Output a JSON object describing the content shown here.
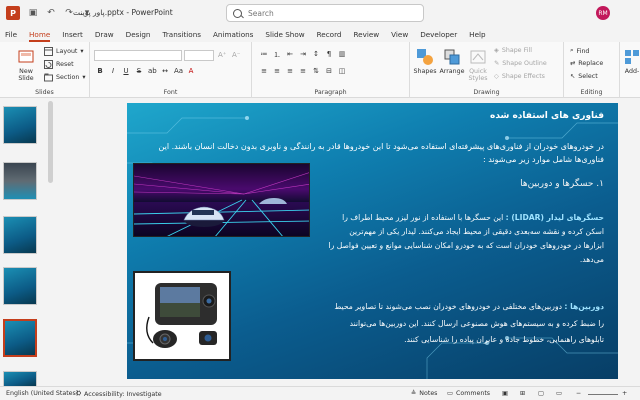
{
  "titlebar": {
    "doc_title": "پاور پوینت.pptx  -  PowerPoint",
    "search_placeholder": "Search",
    "avatar_initials": "RM"
  },
  "tabs": [
    "File",
    "Home",
    "Insert",
    "Draw",
    "Design",
    "Transitions",
    "Animations",
    "Slide Show",
    "Record",
    "Review",
    "View",
    "Developer",
    "Help"
  ],
  "active_tab": "Home",
  "ribbon": {
    "slides": {
      "new_slide": "New\nSlide",
      "layout": "Layout",
      "reset": "Reset",
      "section": "Section",
      "label": "Slides"
    },
    "font": {
      "label": "Font"
    },
    "paragraph": {
      "label": "Paragraph"
    },
    "drawing": {
      "shapes": "Shapes",
      "arrange": "Arrange",
      "quick_styles": "Quick\nStyles",
      "shape_fill": "Shape Fill",
      "shape_outline": "Shape Outline",
      "shape_effects": "Shape Effects",
      "label": "Drawing"
    },
    "editing": {
      "find": "Find",
      "replace": "Replace",
      "select": "Select",
      "label": "Editing"
    },
    "addins": {
      "label": "Add-"
    }
  },
  "slide": {
    "title": "فناوری های استفاده شده",
    "intro": "در خودروهای خودران از فناوری‌های پیشرفته‌ای استفاده می‌شود تا این خودروها قادر به رانندگی و ناوبری بدون دخالت انسان باشند. این فناوری‌ها شامل موارد زیر می‌شوند :",
    "heading": "۱. حسگرها و دوربین‌ها",
    "lidar_label": "حسگرهای لیدار  (LIDAR) :",
    "lidar_text": "این حسگرها با استفاده از نور لیزر محیط اطراف را اسکن کرده و نقشه سه‌بعدی دقیقی از محیط ایجاد می‌کنند. لیدار یکی از مهم‌ترین ابزارها در خودروهای خودران است که به خودرو امکان شناسایی موانع و تعیین فواصل را می‌دهد.",
    "camera_label": "دوربین‌ها :",
    "camera_text": "دوربین‌های مختلفی در خودروهای خودران نصب می‌شوند تا تصاویر محیط را ضبط کرده و به سیستم‌های هوش مصنوعی ارسال کنند. این دوربین‌ها می‌توانند تابلوهای راهنمایی، خطوط جاده و عابران پیاده را شناسایی کنند."
  },
  "status": {
    "language": "English (United States)",
    "accessibility": "Accessibility: Investigate",
    "notes": "Notes",
    "comments": "Comments"
  },
  "colors": {
    "accent": "#c43e1c",
    "slide_bg": "#0f7fb0"
  }
}
